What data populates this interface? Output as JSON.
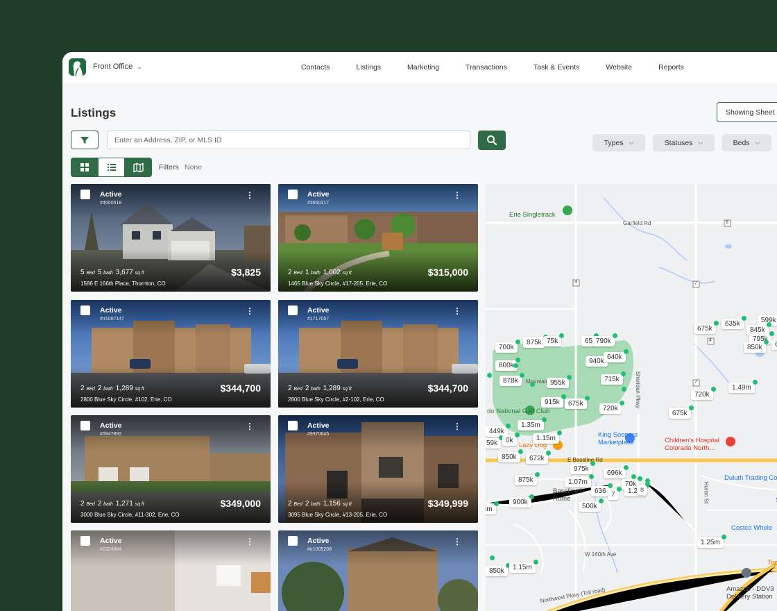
{
  "brand": {
    "name": "Front Office"
  },
  "nav": [
    "Contacts",
    "Listings",
    "Marketing",
    "Transactions",
    "Task & Events",
    "Website",
    "Reports"
  ],
  "page": {
    "title": "Listings",
    "showing_sheet": "Showing Sheet"
  },
  "search": {
    "placeholder": "Enter an Address, ZIP, or MLS ID"
  },
  "pills": {
    "types": "Types",
    "statuses": "Statuses",
    "beds": "Beds"
  },
  "filters": {
    "label": "Filters",
    "value": "None"
  },
  "listings": [
    {
      "status": "Active",
      "mls": "#4600518",
      "beds": "5",
      "baths": "5",
      "sqft": "3,677",
      "bed_unit": "Bed",
      "bath_unit": "bath",
      "sqft_unit": "sq ft",
      "address": "1586 E 166th Place, Thornton, CO",
      "price": "$3,825"
    },
    {
      "status": "Active",
      "mls": "#3550317",
      "beds": "2",
      "baths": "1",
      "sqft": "1,002",
      "bed_unit": "Bed",
      "bath_unit": "bath",
      "sqft_unit": "sq ft",
      "address": "1465 Blue Sky Circle, #17-205, Erie, CO",
      "price": "$315,000"
    },
    {
      "status": "Active",
      "mls": "#ir1007147",
      "beds": "2",
      "baths": "2",
      "sqft": "1,289",
      "bed_unit": "Bed",
      "bath_unit": "bath",
      "sqft_unit": "sq ft",
      "address": "2800 Blue Sky Circle, #102, Erie, CO",
      "price": "$344,700"
    },
    {
      "status": "Active",
      "mls": "#1717057",
      "beds": "2",
      "baths": "2",
      "sqft": "1,289",
      "bed_unit": "Bed",
      "bath_unit": "bath",
      "sqft_unit": "sq ft",
      "address": "2800 Blue Sky Circle, #2-102, Erie, CO",
      "price": "$344,700"
    },
    {
      "status": "Active",
      "mls": "#5947892",
      "beds": "2",
      "baths": "2",
      "sqft": "1,271",
      "bed_unit": "Bed",
      "bath_unit": "bath",
      "sqft_unit": "sq ft",
      "address": "3000 Blue Sky Circle, #11-302, Erie, CO",
      "price": "$349,000"
    },
    {
      "status": "Active",
      "mls": "#9370645",
      "beds": "2",
      "baths": "2",
      "sqft": "1,156",
      "bed_unit": "Bed",
      "bath_unit": "bath",
      "sqft_unit": "sq ft",
      "address": "3095 Blue Sky Circle, #13-205, Erie, CO",
      "price": "$349,999"
    },
    {
      "status": "Active",
      "mls": "#2324984"
    },
    {
      "status": "Active",
      "mls": "#ir1005208"
    }
  ],
  "map": {
    "places": [
      "Erie Singletrack",
      "King Soopers Marketplace",
      "Children's Hospital Colorado North...",
      "Duluth Trading Co",
      "Costco Whole",
      "Amazon - DDV3 Delivery Station",
      "Lazy Dog",
      "Baseline b Home",
      "Topgo",
      "do National Golf Club",
      "Sh"
    ],
    "roads": [
      "Garfield Rd",
      "W 160th Ave",
      "Northwest Pkwy (Toll road)",
      "Sheridan Pkwy",
      "Huron St",
      "E Baseline Rd",
      "Mountain"
    ],
    "route_shields": [
      "3",
      "7",
      "6",
      "4",
      "7"
    ],
    "price_markers": [
      "700k",
      "875k",
      "75k",
      "65",
      "790k",
      "800k",
      "940k",
      "640k",
      "878k",
      "955k",
      "715k",
      "915k",
      "675k",
      "720k",
      "449k",
      "1.35m",
      "1.15m",
      "59k",
      "0k",
      "850k",
      "672k",
      "975k",
      "696k",
      "875k",
      "1.07m",
      "70k",
      "1.2m",
      "636",
      "7",
      "900k",
      "500k",
      "im",
      "1.25m",
      "850k",
      "1.15m",
      "675k",
      "635k",
      "599k",
      "845k",
      "795k",
      "850k",
      "65",
      "1.49m",
      "720k",
      "675k",
      "s"
    ],
    "colors": {
      "marker_dot": "#1fbf74",
      "golf_green": "#a8dab5",
      "water": "#aecbfa",
      "freeway": "#f9c74f"
    }
  },
  "colors": {
    "brand_green": "#2e6b46",
    "background": "#1f3d28"
  }
}
